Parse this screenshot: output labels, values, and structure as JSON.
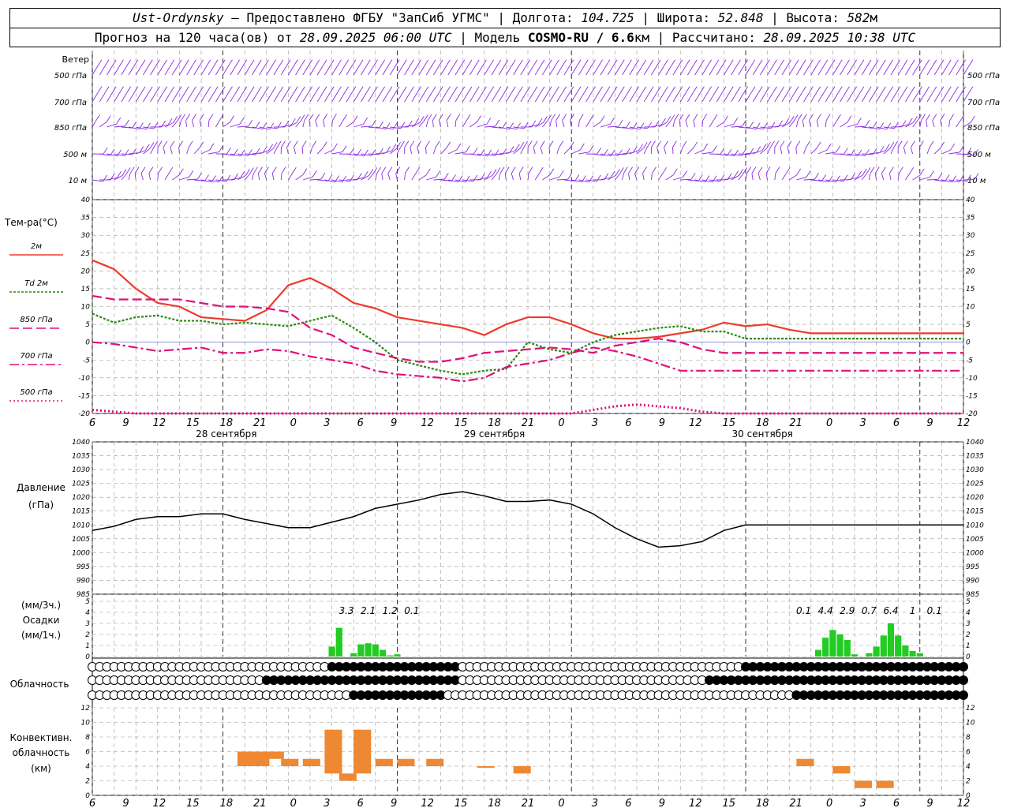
{
  "header": {
    "station": "Ust-Ordynsky",
    "provider": " — Предоставлено ФГБУ \"ЗапСиб УГМС\" | ",
    "lon_label": "Долгота: ",
    "lon": "104.725",
    "lat_label": " | Широта: ",
    "lat": "52.848",
    "alt_label": " | Высота: ",
    "alt": "582",
    "alt_unit": "м",
    "fc_prefix": "Прогноз на 120 часа(ов) от ",
    "fc_start": "28.09.2025 06:00 UTC",
    "model_label": " | Модель ",
    "model": "COSMO-RU / 6.6",
    "model_unit": "км",
    "calc_label": " | Рассчитано: ",
    "calc_time": "28.09.2025 10:38 UTC"
  },
  "colors": {
    "wind": "#8a2be2",
    "t2m": "#ee3a2a",
    "td2m": "#2a8a10",
    "t850": "#dd1177",
    "t700": "#dd1177",
    "t500": "#dd1177",
    "pressure": "#000000",
    "precip": "#22cc22",
    "precip_snow": "#3344cc",
    "convective": "#ee8833",
    "grid": "#999999"
  },
  "x_axis": {
    "hour_ticks": [
      "6",
      "9",
      "12",
      "15",
      "18",
      "21",
      "0",
      "3",
      "6",
      "9",
      "12",
      "15",
      "18",
      "21",
      "0",
      "3",
      "6",
      "9",
      "12",
      "15",
      "18",
      "21",
      "0",
      "3",
      "6",
      "9",
      "12"
    ],
    "dates": [
      "28 сентября",
      "29 сентября",
      "30 сентября"
    ]
  },
  "wind_panel": {
    "title": "Ветер",
    "levels_left": [
      "500 гПа",
      "700 гПа",
      "850 гПа",
      "500 м",
      "10  м"
    ],
    "levels_right": [
      "500 гПа",
      "700 гПа",
      "850 гПа",
      "500 м",
      "10  м"
    ]
  },
  "temp_panel": {
    "title": "Тем-ра(°C)",
    "legend": [
      "2м",
      "Td  2м",
      "850 гПа",
      "700 гПа",
      "500 гПа"
    ],
    "ticks": [
      "40",
      "35",
      "30",
      "25",
      "20",
      "15",
      "10",
      "5",
      "0",
      "-5",
      "-10",
      "-15",
      "-20"
    ]
  },
  "pressure_panel": {
    "title": "Давление",
    "unit": "(гПа)",
    "ticks": [
      "1040",
      "1035",
      "1030",
      "1025",
      "1020",
      "1015",
      "1010",
      "1005",
      "1000",
      "995",
      "990",
      "985"
    ]
  },
  "precip_panel": {
    "unit_3h": "(мм/3ч.)",
    "title": "Осадки",
    "unit_1h": "(мм/1ч.)",
    "ticks": [
      "5",
      "4",
      "3",
      "2",
      "1",
      "0"
    ],
    "sums": [
      {
        "hour": 35,
        "text": "3.3"
      },
      {
        "hour": 38,
        "text": "2.1"
      },
      {
        "hour": 41,
        "text": "1.2"
      },
      {
        "hour": 44,
        "text": "0.1"
      },
      {
        "hour": 98,
        "text": "0.1"
      },
      {
        "hour": 101,
        "text": "4.4"
      },
      {
        "hour": 104,
        "text": "2.9"
      },
      {
        "hour": 107,
        "text": "0.7"
      },
      {
        "hour": 110,
        "text": "6.4"
      },
      {
        "hour": 113,
        "text": "1"
      },
      {
        "hour": 116,
        "text": "0.1"
      }
    ]
  },
  "cloud_panel": {
    "title": "Облачность"
  },
  "conv_panel": {
    "title_1": "Конвективн.",
    "title_2": "облачность",
    "unit": "(км)",
    "ticks": [
      "12",
      "10",
      "8",
      "6",
      "4",
      "2",
      "0"
    ]
  },
  "chart_data": [
    {
      "type": "line",
      "title": "Тем-ра(°C)",
      "x_unit": "hours since 28.09.2025 06:00 UTC",
      "ylim": [
        -20,
        40
      ],
      "series": [
        {
          "name": "2м",
          "x": [
            0,
            3,
            6,
            9,
            12,
            15,
            18,
            21,
            24,
            27,
            30,
            33,
            36,
            39,
            42,
            45,
            48,
            51,
            54,
            57,
            60,
            63,
            66,
            69,
            72,
            75,
            78,
            81,
            84,
            87,
            90,
            93,
            96,
            99,
            102,
            105,
            108,
            111,
            114,
            117,
            120
          ],
          "values": [
            23,
            20.5,
            15,
            11,
            10,
            7,
            6.5,
            6,
            9,
            16,
            18,
            15,
            11,
            9.5,
            7,
            6,
            5,
            4,
            2,
            5,
            7,
            7,
            5,
            2.5,
            1,
            1,
            1.5,
            2.5,
            3.5,
            5.5,
            4.5,
            5,
            3.5,
            2.5,
            2.5,
            2.5,
            2.5,
            2.5,
            2.5,
            2.5,
            2.5
          ]
        },
        {
          "name": "Td  2м",
          "x": [
            0,
            3,
            6,
            9,
            12,
            15,
            18,
            21,
            24,
            27,
            30,
            33,
            36,
            39,
            42,
            45,
            48,
            51,
            54,
            57,
            60,
            63,
            66,
            69,
            72,
            75,
            78,
            81,
            84,
            87,
            90,
            93,
            96,
            99,
            102,
            105,
            108,
            111,
            114,
            117,
            120
          ],
          "values": [
            8,
            5.5,
            7,
            7.5,
            6,
            6,
            5,
            5.5,
            5,
            4.5,
            6,
            7.5,
            4,
            0,
            -5,
            -6.5,
            -8,
            -9,
            -8,
            -7.5,
            0,
            -2,
            -3,
            0,
            2,
            3,
            4,
            4.5,
            3,
            3,
            1,
            1,
            1,
            1,
            1,
            1,
            1,
            1,
            1,
            1,
            1
          ]
        },
        {
          "name": "850 гПа",
          "x": [
            0,
            3,
            6,
            9,
            12,
            15,
            18,
            21,
            24,
            27,
            30,
            33,
            36,
            39,
            42,
            45,
            48,
            51,
            54,
            57,
            60,
            63,
            66,
            69,
            72,
            75,
            78,
            81,
            84,
            87,
            90,
            93,
            96,
            99,
            102,
            105,
            108,
            111,
            114,
            117,
            120
          ],
          "values": [
            13,
            12,
            12,
            12,
            12,
            11,
            10,
            10,
            9.5,
            8.5,
            4,
            2,
            -1.5,
            -3,
            -4.5,
            -5.5,
            -5.5,
            -4.5,
            -3,
            -2.5,
            -2,
            -1.5,
            -2,
            -3,
            -1,
            0,
            1,
            0,
            -2,
            -3,
            -3,
            -3,
            -3,
            -3,
            -3,
            -3,
            -3,
            -3,
            -3,
            -3,
            -3
          ]
        },
        {
          "name": "700 гПа",
          "x": [
            0,
            3,
            6,
            9,
            12,
            15,
            18,
            21,
            24,
            27,
            30,
            33,
            36,
            39,
            42,
            45,
            48,
            51,
            54,
            57,
            60,
            63,
            66,
            69,
            72,
            75,
            78,
            81,
            84,
            87,
            90,
            93,
            96,
            99,
            102,
            105,
            108,
            111,
            114,
            117,
            120
          ],
          "values": [
            0,
            -0.5,
            -1.5,
            -2.5,
            -2,
            -1.5,
            -3,
            -3,
            -2,
            -2.5,
            -4,
            -5,
            -6,
            -8,
            -9,
            -9.5,
            -10,
            -11,
            -10,
            -7,
            -6,
            -5,
            -3,
            -1.5,
            -2.5,
            -4,
            -6,
            -8,
            -8,
            -8,
            -8,
            -8,
            -8,
            -8,
            -8,
            -8,
            -8,
            -8,
            -8,
            -8,
            -8
          ]
        },
        {
          "name": "500 гПа",
          "x": [
            0,
            3,
            6,
            9,
            12,
            15,
            18,
            21,
            24,
            27,
            30,
            33,
            36,
            39,
            42,
            45,
            48,
            51,
            54,
            57,
            60,
            63,
            66,
            69,
            72,
            75,
            78,
            81,
            84,
            87,
            90,
            93,
            96,
            99,
            102,
            105,
            108,
            111,
            114,
            117,
            120
          ],
          "values": [
            -19,
            -19.5,
            -20,
            -20,
            -20,
            -20,
            -20,
            -20,
            -20,
            -20,
            -20,
            -20,
            -20,
            -20,
            -20,
            -20,
            -20,
            -20,
            -20,
            -20,
            -20,
            -20,
            -20,
            -19,
            -18,
            -17.5,
            -18,
            -18.5,
            -19.5,
            -20,
            -20,
            -20,
            -20,
            -20,
            -20,
            -20,
            -20,
            -20,
            -20,
            -20,
            -20
          ]
        }
      ]
    },
    {
      "type": "line",
      "title": "Давление",
      "x_unit": "hours since 28.09.2025 06:00 UTC",
      "ylim": [
        985,
        1040
      ],
      "series": [
        {
          "name": "Давление",
          "x": [
            0,
            3,
            6,
            9,
            12,
            15,
            18,
            21,
            24,
            27,
            30,
            33,
            36,
            39,
            42,
            45,
            48,
            51,
            54,
            57,
            60,
            63,
            66,
            69,
            72,
            75,
            78,
            81,
            84,
            87,
            90,
            93,
            96,
            99,
            102,
            105,
            108,
            111,
            114,
            117,
            120
          ],
          "values": [
            1008,
            1009.5,
            1012,
            1013,
            1013,
            1014,
            1014,
            1012,
            1010.5,
            1009,
            1009,
            1011,
            1013,
            1016,
            1017.5,
            1019,
            1021,
            1022,
            1020.5,
            1018.5,
            1018.5,
            1019,
            1017.5,
            1014,
            1009,
            1005,
            1002,
            1002.5,
            1004,
            1008,
            1010,
            1010,
            1010,
            1010,
            1010,
            1010,
            1010,
            1010,
            1010,
            1010,
            1010
          ]
        }
      ]
    },
    {
      "type": "bar",
      "title": "Осадки",
      "x_unit": "hours since 28.09.2025 06:00 UTC",
      "ylim": [
        0,
        5
      ],
      "bars": [
        {
          "x": 33,
          "value": 0.9
        },
        {
          "x": 34,
          "value": 2.6
        },
        {
          "x": 36,
          "value": 0.3
        },
        {
          "x": 37,
          "value": 1.1
        },
        {
          "x": 38,
          "value": 1.2
        },
        {
          "x": 39,
          "value": 1.1
        },
        {
          "x": 40,
          "value": 0.6
        },
        {
          "x": 41,
          "value": 0.1
        },
        {
          "x": 42,
          "value": 0.2
        },
        {
          "x": 100,
          "value": 0.6
        },
        {
          "x": 101,
          "value": 1.7
        },
        {
          "x": 102,
          "value": 2.4
        },
        {
          "x": 103,
          "value": 2.0
        },
        {
          "x": 104,
          "value": 1.5
        },
        {
          "x": 105,
          "value": 0.2
        },
        {
          "x": 107,
          "value": 0.3
        },
        {
          "x": 108,
          "value": 0.9
        },
        {
          "x": 109,
          "value": 1.9
        },
        {
          "x": 110,
          "value": 3.0
        },
        {
          "x": 111,
          "value": 1.9
        },
        {
          "x": 112,
          "value": 1.0
        },
        {
          "x": 113,
          "value": 0.5
        },
        {
          "x": 114,
          "value": 0.3
        }
      ]
    },
    {
      "type": "bar",
      "title": "Конвективн. облачность",
      "x_unit": "hours since 28.09.2025 06:00 UTC",
      "ylim": [
        0,
        12
      ],
      "bars": [
        {
          "x": 21,
          "bottom": 4,
          "top": 6
        },
        {
          "x": 23,
          "bottom": 4,
          "top": 6
        },
        {
          "x": 25,
          "bottom": 5,
          "top": 6
        },
        {
          "x": 27,
          "bottom": 4,
          "top": 5
        },
        {
          "x": 30,
          "bottom": 4,
          "top": 5
        },
        {
          "x": 33,
          "bottom": 3,
          "top": 9
        },
        {
          "x": 35,
          "bottom": 2,
          "top": 3
        },
        {
          "x": 37,
          "bottom": 3,
          "top": 9
        },
        {
          "x": 40,
          "bottom": 4,
          "top": 5
        },
        {
          "x": 43,
          "bottom": 4,
          "top": 5
        },
        {
          "x": 47,
          "bottom": 4,
          "top": 5
        },
        {
          "x": 54,
          "bottom": 4,
          "top": 4
        },
        {
          "x": 59,
          "bottom": 3,
          "top": 4
        },
        {
          "x": 98,
          "bottom": 4,
          "top": 5
        },
        {
          "x": 103,
          "bottom": 3,
          "top": 4
        },
        {
          "x": 106,
          "bottom": 1,
          "top": 2
        },
        {
          "x": 109,
          "bottom": 1,
          "top": 2
        }
      ]
    }
  ]
}
